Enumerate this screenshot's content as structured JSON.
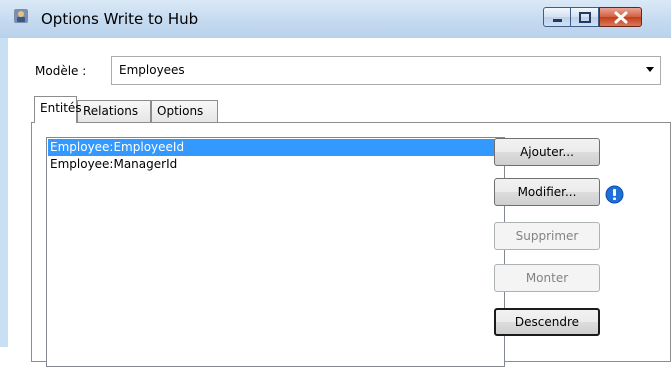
{
  "window": {
    "title": "Options Write to Hub"
  },
  "model": {
    "label": "Modèle :",
    "selected": "Employees"
  },
  "tabs": [
    {
      "label": "Entités",
      "active": true
    },
    {
      "label": "Relations",
      "active": false
    },
    {
      "label": "Options",
      "active": false
    }
  ],
  "list": {
    "items": [
      {
        "label": "Employee:EmployeeId",
        "selected": true
      },
      {
        "label": "Employee:ManagerId",
        "selected": false
      }
    ]
  },
  "buttons": {
    "add": "Ajouter...",
    "edit": "Modifier...",
    "delete": "Supprimer",
    "up": "Monter",
    "down": "Descendre"
  },
  "icons": {
    "app": "app-icon",
    "warning": "info-exclamation-icon"
  },
  "colors": {
    "selection": "#3399ff",
    "close_button": "#c23e1c",
    "warning_icon": "#1f6fd6"
  }
}
